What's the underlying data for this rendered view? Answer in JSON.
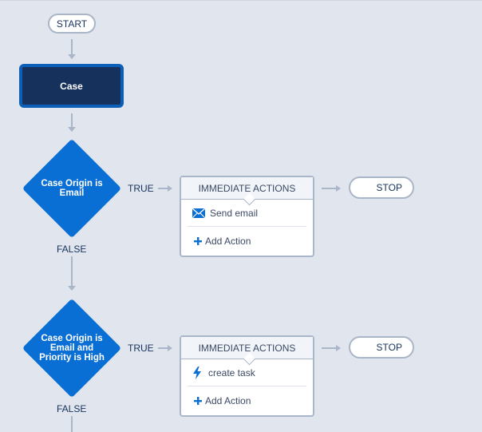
{
  "flow": {
    "start_label": "START",
    "object_node": {
      "label": "Case"
    },
    "criteria": [
      {
        "label": "Case Origin  is Email",
        "label_lines": [
          "Case Origin  is",
          "Email"
        ],
        "true_label": "TRUE",
        "false_label": "FALSE",
        "actions_header": "IMMEDIATE ACTIONS",
        "action": {
          "icon": "envelope-icon",
          "label": "Send email"
        },
        "add_action_label": "Add Action",
        "stop_label": "STOP"
      },
      {
        "label": "Case Origin is Email and Priority is High",
        "label_lines": [
          "Case Origin is",
          "Email and",
          "Priority is High"
        ],
        "true_label": "TRUE",
        "false_label": "FALSE",
        "actions_header": "IMMEDIATE ACTIONS",
        "action": {
          "icon": "lightning-bolt-icon",
          "label": "create task"
        },
        "add_action_label": "Add Action",
        "stop_label": "STOP"
      }
    ]
  },
  "colors": {
    "background": "#e0e5ee",
    "connector": "#a9b6c8",
    "object_fill": "#16325c",
    "object_border": "#0b5fb8",
    "decision_fill": "#0a6fd4",
    "text_dark": "#16325c",
    "icon_blue": "#0a6fd4"
  }
}
